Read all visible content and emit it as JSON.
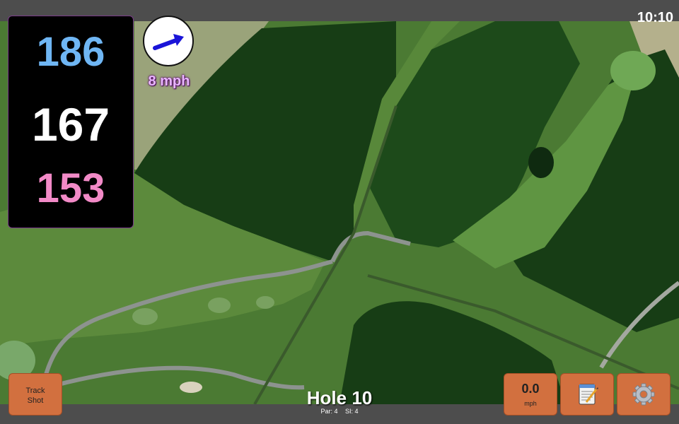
{
  "status_bar": {
    "time": "10:10"
  },
  "yardages": {
    "back": "186",
    "middle": "167",
    "front": "153"
  },
  "wind": {
    "speed_label": "8 mph",
    "icon": "wind-arrow-icon",
    "direction": "northeast"
  },
  "buttons": {
    "track_shot_label": "Track\nShot",
    "wind_value": "0.0",
    "wind_unit": "mph",
    "notes_icon": "notepad-icon",
    "settings_icon": "gear-icon"
  },
  "hole": {
    "title": "Hole 10",
    "par": "Par: 4",
    "si": "SI: 4"
  },
  "colors": {
    "back": "#6fb6f4",
    "middle": "#ffffff",
    "front": "#f28ac7",
    "button": "#d2703f"
  }
}
